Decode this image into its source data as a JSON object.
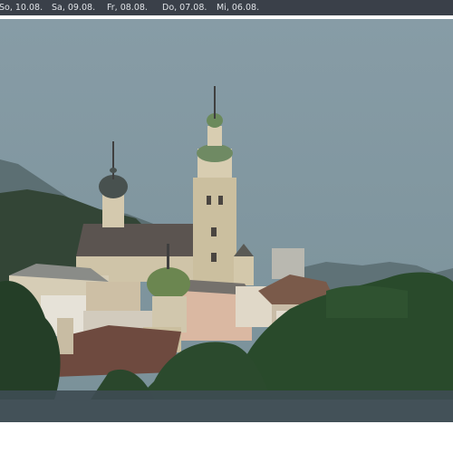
{
  "tabs": [
    {
      "label": "So, 10.08."
    },
    {
      "label": "Sa, 09.08."
    },
    {
      "label": "Fr, 08.08."
    },
    {
      "label": "Do, 07.08."
    },
    {
      "label": "Mi, 06.08."
    }
  ],
  "webcam": {
    "scene": "town-view-with-church-towers",
    "colors": {
      "sky": "#7f97a0",
      "hills": "#3a4c3e",
      "trees": "#27452b",
      "roofs": "#6b4a3e",
      "tower": "#cfc3a3",
      "dome": "#5a7d49",
      "footer_bar": "#3e4c52"
    }
  }
}
